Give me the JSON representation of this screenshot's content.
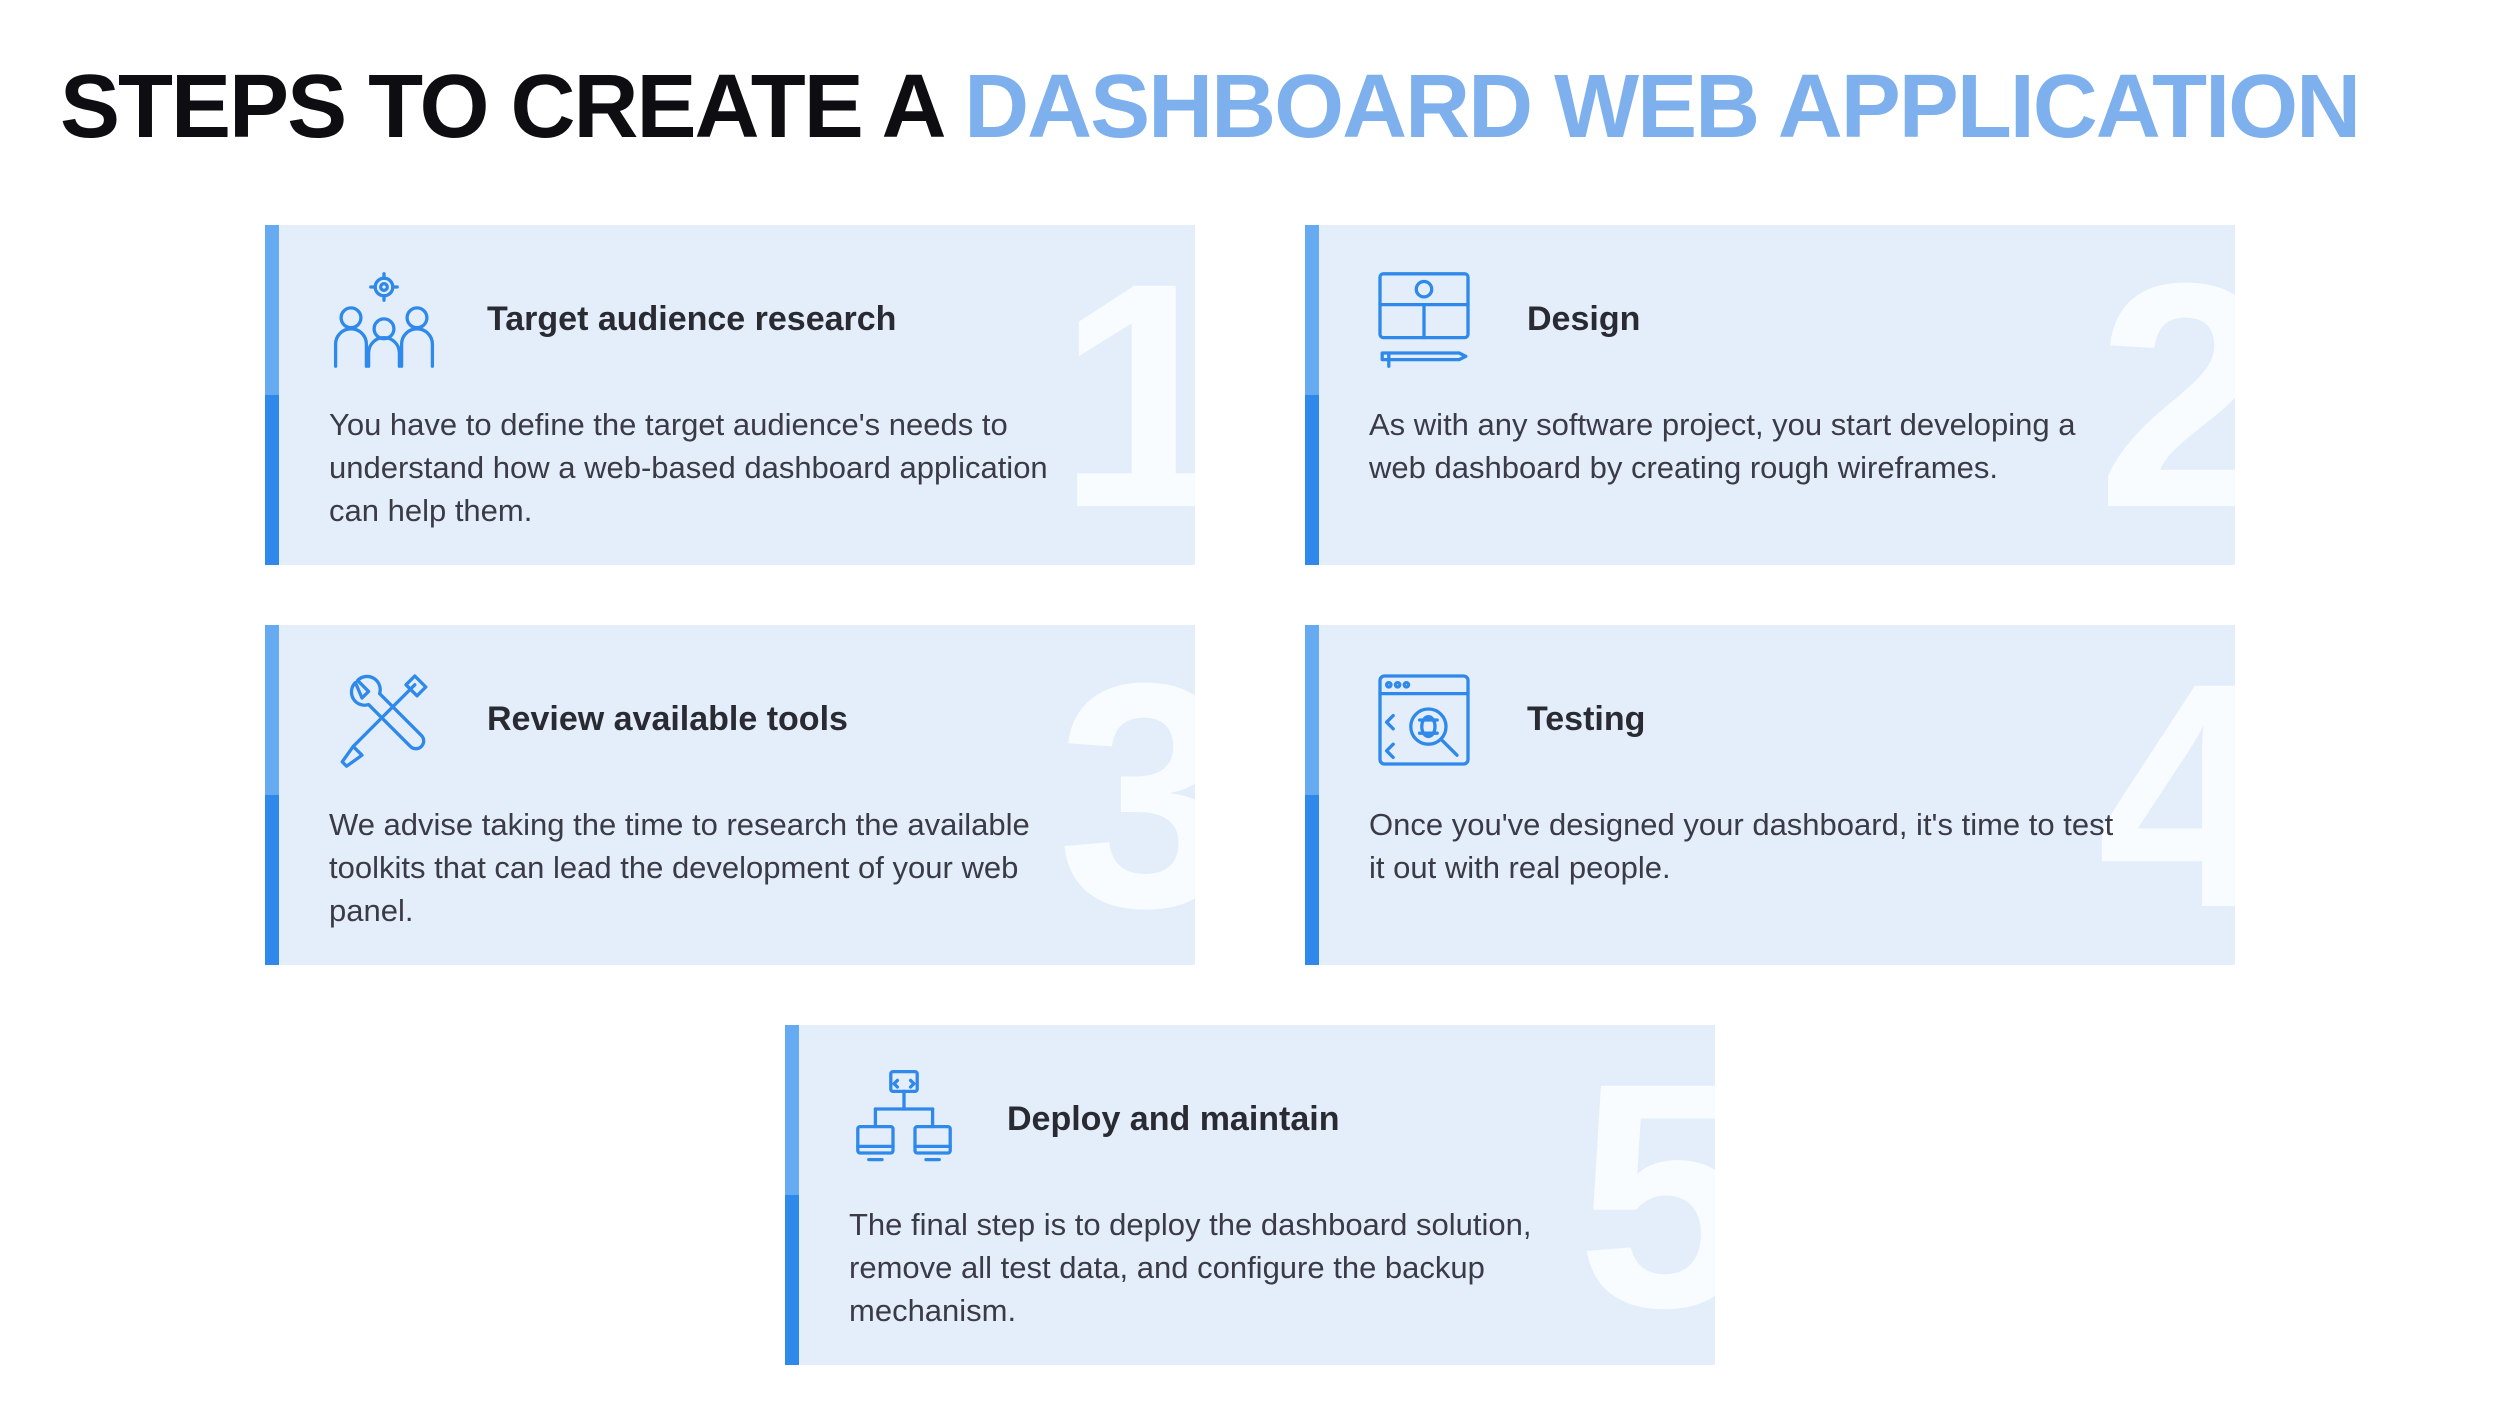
{
  "title": {
    "prefix": "STEPS TO CREATE A ",
    "accent": "DASHBOARD WEB APPLICATION"
  },
  "steps": [
    {
      "num": "1",
      "icon": "audience-icon",
      "title": "Target audience research",
      "body": "You have to define the target audience's needs to understand how a web-based dashboard application can help them."
    },
    {
      "num": "2",
      "icon": "design-icon",
      "title": "Design",
      "body": "As with any software project, you start developing a web dashboard by creating rough wireframes."
    },
    {
      "num": "3",
      "icon": "tools-icon",
      "title": "Review available tools",
      "body": "We advise taking the time to research the available toolkits that can lead the development of your web panel."
    },
    {
      "num": "4",
      "icon": "testing-icon",
      "title": "Testing",
      "body": "Once you've designed your dashboard, it's time to test it out with real people."
    },
    {
      "num": "5",
      "icon": "deploy-icon",
      "title": "Deploy and maintain",
      "body": "The final step is to deploy the dashboard solution, remove all test data, and configure the backup mechanism."
    }
  ]
}
